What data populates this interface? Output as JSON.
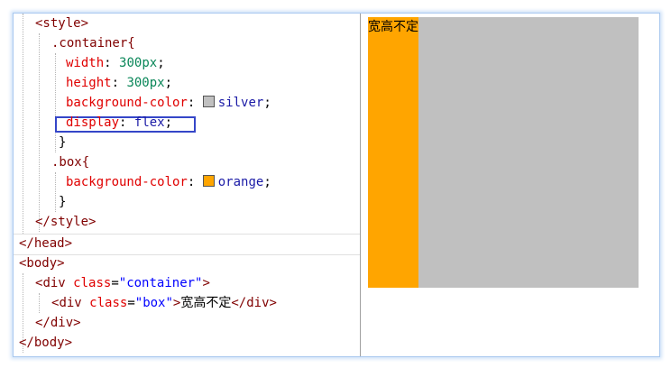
{
  "code": {
    "style_open": "<style>",
    "container_selector": ".container{",
    "width_prop": "width",
    "width_val": "300px",
    "height_prop": "height",
    "height_val": "300px",
    "bg_prop": "background-color",
    "bg_val": "silver",
    "display_prop": "display",
    "display_val": "flex",
    "close_brace": "}",
    "box_selector": ".box{",
    "box_bg_prop": "background-color",
    "box_bg_val": "orange",
    "style_close": "</style>",
    "head_close": "</head>",
    "body_open": "<body>",
    "div_open_tag": "div",
    "class_attr": "class",
    "container_class": "\"container\"",
    "box_class": "\"box\"",
    "box_text": "宽高不定",
    "div_close": "</div>",
    "body_close": "</body>",
    "colon": ":",
    "semicolon": ";"
  },
  "preview": {
    "box_text": "宽高不定",
    "container_color": "#c0c0c0",
    "box_color": "#ffa500"
  }
}
